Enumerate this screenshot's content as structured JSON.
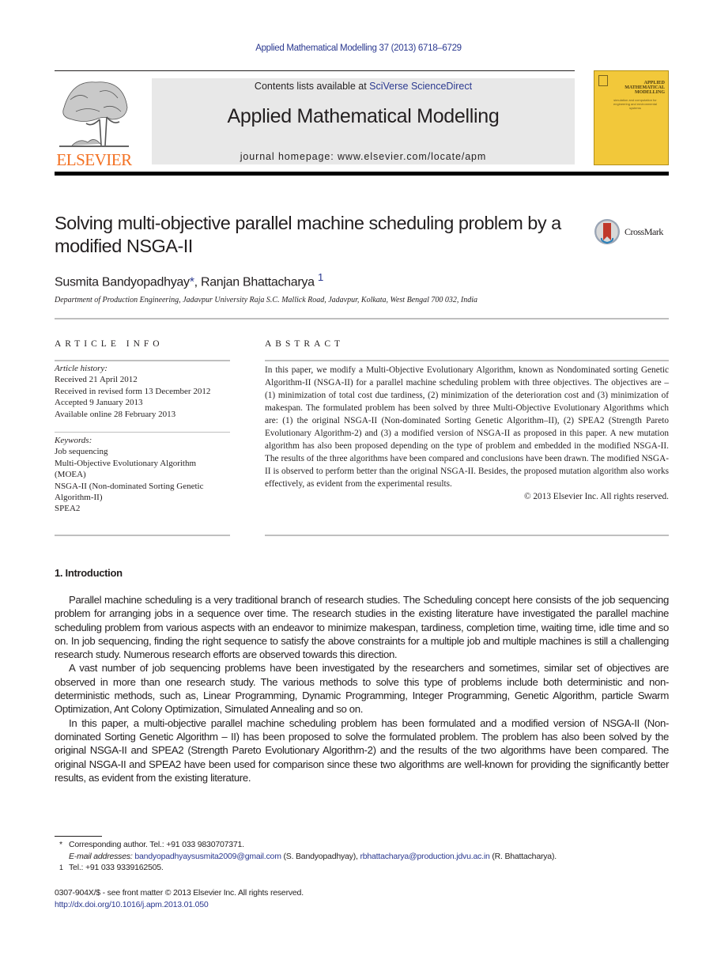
{
  "citation": "Applied Mathematical Modelling 37 (2013) 6718–6729",
  "header": {
    "publisher_logo_text": "ELSEVIER",
    "contents_prefix": "Contents lists available at ",
    "contents_link": "SciVerse ScienceDirect",
    "journal_name": "Applied Mathematical Modelling",
    "homepage": "journal homepage: www.elsevier.com/locate/apm",
    "cover": {
      "title": "APPLIED MATHEMATICAL MODELLING",
      "subtitle": "simulation and computation for engineering and environmental systems"
    },
    "brand_colors": {
      "elsevier_orange": "#f37021",
      "link_blue": "#2b3990",
      "cover_yellow": "#f2c83a"
    }
  },
  "article": {
    "title": "Solving multi-objective parallel machine scheduling problem by a modified NSGA-II",
    "crossmark_label": "CrossMark",
    "authors": [
      {
        "name": "Susmita Bandyopadhyay",
        "mark": "*"
      },
      {
        "name": "Ranjan Bhattacharya",
        "mark": "1"
      }
    ],
    "author_separator": ", ",
    "affiliation": "Department of Production Engineering, Jadavpur University Raja S.C. Mallick Road, Jadavpur, Kolkata, West Bengal 700 032, India"
  },
  "article_info": {
    "heading": "ARTICLE INFO",
    "history_label": "Article history:",
    "history": [
      "Received 21 April 2012",
      "Received in revised form 13 December 2012",
      "Accepted 9 January 2013",
      "Available online 28 February 2013"
    ],
    "keywords_label": "Keywords:",
    "keywords": [
      "Job sequencing",
      "Multi-Objective Evolutionary Algorithm (MOEA)",
      "NSGA-II (Non-dominated Sorting Genetic Algorithm-II)",
      "SPEA2"
    ]
  },
  "abstract": {
    "heading": "ABSTRACT",
    "text": "In this paper, we modify a Multi-Objective Evolutionary Algorithm, known as Nondominated sorting Genetic Algorithm-II (NSGA-II) for a parallel machine scheduling problem with three objectives. The objectives are – (1) minimization of total cost due tardiness, (2) minimization of the deterioration cost and (3) minimization of makespan. The formulated problem has been solved by three Multi-Objective Evolutionary Algorithms which are: (1) the original NSGA-II (Non-dominated Sorting Genetic Algorithm–II), (2) SPEA2 (Strength Pareto Evolutionary Algorithm-2) and (3) a modified version of NSGA-II as proposed in this paper. A new mutation algorithm has also been proposed depending on the type of problem and embedded in the modified NSGA-II. The results of the three algorithms have been compared and conclusions have been drawn. The modified NSGA-II is observed to perform better than the original NSGA-II. Besides, the proposed mutation algorithm also works effectively, as evident from the experimental results.",
    "copyright": "© 2013 Elsevier Inc. All rights reserved."
  },
  "introduction": {
    "heading": "1. Introduction",
    "paragraphs": [
      "Parallel machine scheduling is a very traditional branch of research studies. The Scheduling concept here consists of the job sequencing problem for arranging jobs in a sequence over time. The research studies in the existing literature have investigated the parallel machine scheduling problem from various aspects with an endeavor to minimize makespan, tardiness, completion time, waiting time, idle time and so on. In job sequencing, finding the right sequence to satisfy the above constraints for a multiple job and multiple machines is still a challenging research study. Numerous research efforts are observed towards this direction.",
      "A vast number of job sequencing problems have been investigated by the researchers and sometimes, similar set of objectives are observed in more than one research study. The various methods to solve this type of problems include both deterministic and non-deterministic methods, such as, Linear Programming, Dynamic Programming, Integer Programming, Genetic Algorithm, particle Swarm Optimization, Ant Colony Optimization, Simulated Annealing and so on.",
      "In this paper, a multi-objective parallel machine scheduling problem has been formulated and a modified version of NSGA-II (Non-dominated Sorting Genetic Algorithm – II) has been proposed to solve the formulated problem. The problem has also been solved by the original NSGA-II and SPEA2 (Strength Pareto Evolutionary Algorithm-2) and the results of the two algorithms have been compared. The original NSGA-II and SPEA2 have been used for comparison since these two algorithms are well-known for providing the significantly better results, as evident from the existing literature."
    ]
  },
  "footnotes": {
    "corresponding_mark": "*",
    "corresponding": "Corresponding author. Tel.: +91 033 9830707371.",
    "email_label": "E-mail addresses:",
    "email1": "bandyopadhyaysusmita2009@gmail.com",
    "email1_owner": " (S. Bandyopadhyay), ",
    "email2": "rbhattacharya@production.jdvu.ac.in",
    "email2_owner": " (R. Bhattacharya).",
    "note1_mark": "1",
    "note1": "Tel.: +91 033 9339162505."
  },
  "bottom": {
    "issn_line": "0307-904X/$ - see front matter © 2013 Elsevier Inc. All rights reserved.",
    "doi": "http://dx.doi.org/10.1016/j.apm.2013.01.050"
  }
}
